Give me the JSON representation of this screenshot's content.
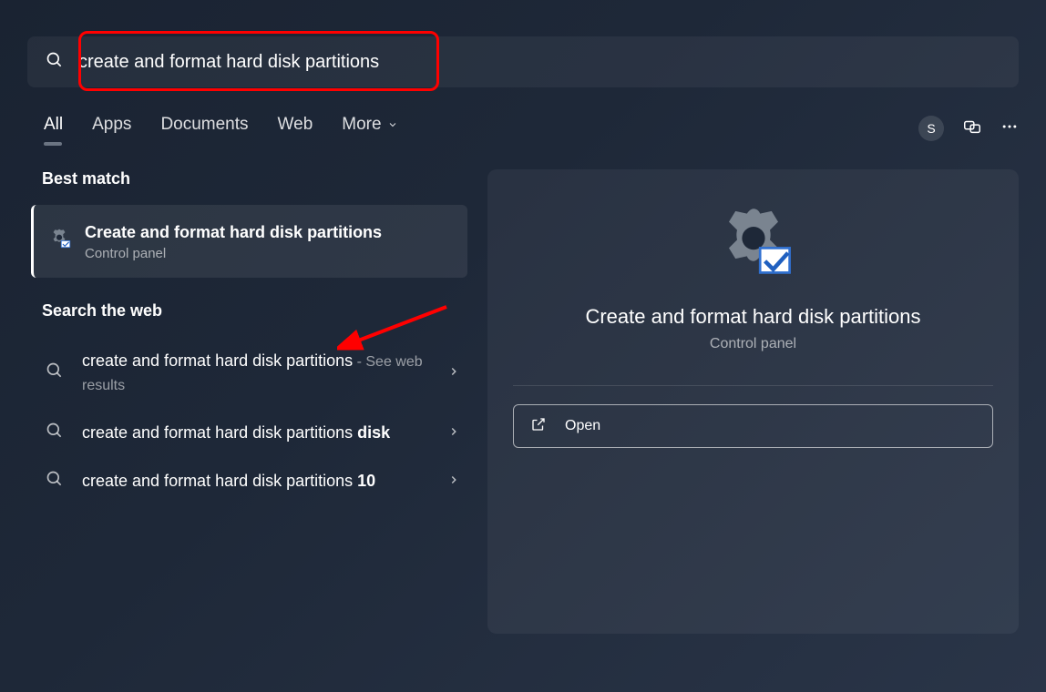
{
  "search": {
    "query": "create and format hard disk partitions"
  },
  "tabs": {
    "all": "All",
    "apps": "Apps",
    "documents": "Documents",
    "web": "Web",
    "more": "More"
  },
  "avatar_letter": "S",
  "left": {
    "best_match_heading": "Best match",
    "best_match": {
      "title": "Create and format hard disk partitions",
      "subtitle": "Control panel"
    },
    "web_heading": "Search the web",
    "web_results": [
      {
        "text": "create and format hard disk partitions",
        "suffix": " - See web results",
        "bold": ""
      },
      {
        "text": "create and format hard disk partitions ",
        "suffix": "",
        "bold": "disk"
      },
      {
        "text": "create and format hard disk partitions ",
        "suffix": "",
        "bold": "10"
      }
    ]
  },
  "detail": {
    "title": "Create and format hard disk partitions",
    "subtitle": "Control panel",
    "open_label": "Open"
  }
}
